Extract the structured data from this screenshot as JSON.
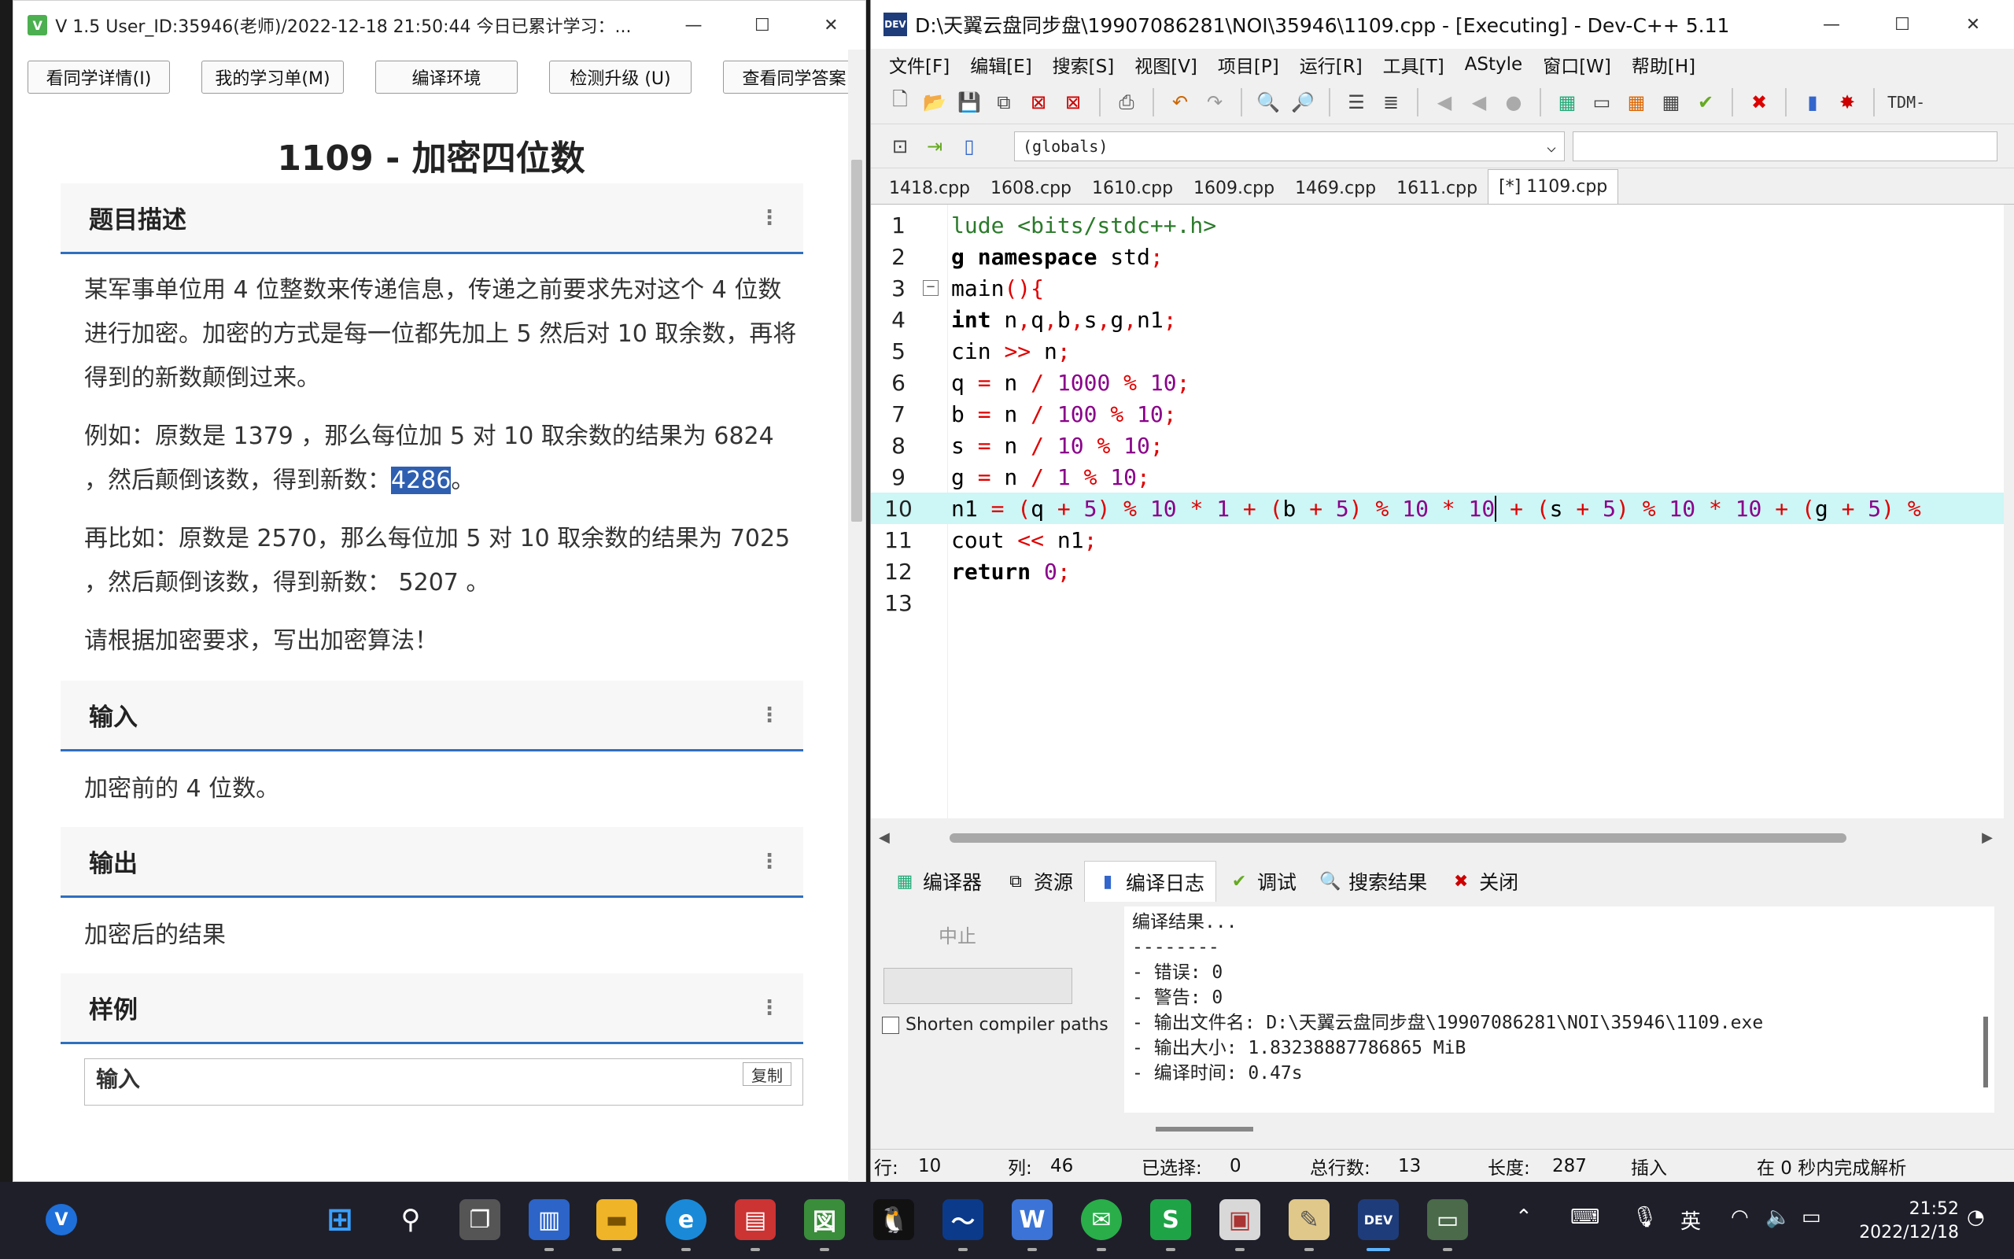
{
  "left_window": {
    "app_icon": "V",
    "title": "V 1.5 User_ID:35946(老师)/2022-12-18 21:50:44 今日已累计学习：...",
    "controls": {
      "minimize": "—",
      "maximize": "☐",
      "close": "✕"
    },
    "buttons": [
      "看同学详情(I)",
      "我的学习单(M)",
      "编译环境",
      "检测升级 (U)",
      "查看同学答案"
    ],
    "problem_title": "1109 - 加密四位数",
    "sections": {
      "description": {
        "heading": "题目描述",
        "p1": "某军事单位用 4 位整数来传递信息，传递之前要求先对这个 4 位数进行加密。加密的方式是每一位都先加上 5 然后对 10 取余数，再将得到的新数颠倒过来。",
        "p2_before": "例如：原数是 1379 ，那么每位加 5 对 10 取余数的结果为 6824 ，然后颠倒该数，得到新数：",
        "p2_highlight": "4286",
        "p2_after": "。",
        "p3": "再比如：原数是 2570，那么每位加 5 对 10 取余数的结果为 7025 ，然后颠倒该数，得到新数： 5207 。",
        "p4": "请根据加密要求，写出加密算法！"
      },
      "input": {
        "heading": "输入",
        "body": "加密前的 4 位数。"
      },
      "output": {
        "heading": "输出",
        "body": "加密后的结果"
      },
      "sample": {
        "heading": "样例",
        "input_label": "输入",
        "copy_label": "复制"
      }
    }
  },
  "right_window": {
    "app_icon": "DEV",
    "title": "D:\\天翼云盘同步盘\\19907086281\\NOI\\35946\\1109.cpp - [Executing] - Dev-C++ 5.11",
    "controls": {
      "minimize": "—",
      "maximize": "☐",
      "close": "✕"
    },
    "menu": [
      "文件[F]",
      "编辑[E]",
      "搜索[S]",
      "视图[V]",
      "项目[P]",
      "运行[R]",
      "工具[T]",
      "AStyle",
      "窗口[W]",
      "帮助[H]"
    ],
    "toolbar_end_label": "TDM-",
    "scope_select": "(globals)",
    "file_tabs": [
      "1418.cpp",
      "1608.cpp",
      "1610.cpp",
      "1609.cpp",
      "1469.cpp",
      "1611.cpp",
      "[*] 1109.cpp"
    ],
    "code_lines": [
      {
        "n": "1"
      },
      {
        "n": "2"
      },
      {
        "n": "3"
      },
      {
        "n": "4"
      },
      {
        "n": "5"
      },
      {
        "n": "6"
      },
      {
        "n": "7"
      },
      {
        "n": "8"
      },
      {
        "n": "9"
      },
      {
        "n": "10"
      },
      {
        "n": "11"
      },
      {
        "n": "12"
      },
      {
        "n": "13"
      }
    ],
    "bottom_tabs": [
      "编译器",
      "资源",
      "编译日志",
      "调试",
      "搜索结果",
      "关闭"
    ],
    "abort_label": "中止",
    "shorten_label": "Shorten compiler paths",
    "log": [
      "编译结果...",
      "--------",
      "- 错误: 0",
      "- 警告: 0",
      "- 输出文件名: D:\\天翼云盘同步盘\\19907086281\\NOI\\35946\\1109.exe",
      "- 输出大小: 1.83238887786865 MiB",
      "- 编译时间: 0.47s"
    ],
    "status": {
      "row_label": "行:",
      "row": "10",
      "col_label": "列:",
      "col": "46",
      "sel_label": "已选择:",
      "sel": "0",
      "total_label": "总行数:",
      "total": "13",
      "len_label": "长度:",
      "len": "287",
      "mode": "插入",
      "parse": "在 0 秒内完成解析"
    }
  },
  "taskbar": {
    "ime": "英",
    "time": "21:52",
    "date": "2022/12/18"
  }
}
